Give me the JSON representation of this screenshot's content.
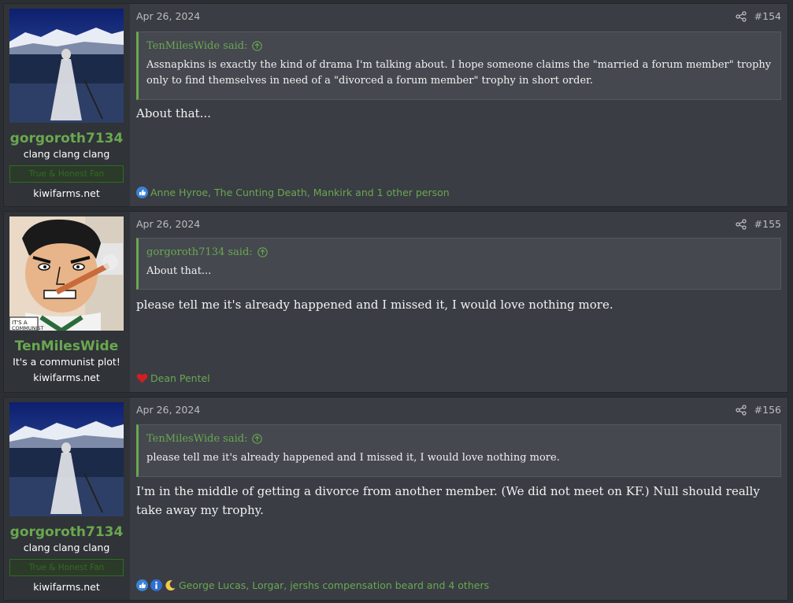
{
  "posts": [
    {
      "username": "gorgoroth7134",
      "user_title": "clang clang clang",
      "banner": "True & Honest Fan",
      "site": "kiwifarms.net",
      "date": "Apr 26, 2024",
      "post_number": "#154",
      "quote": {
        "author": "TenMilesWide said:",
        "text": "Assnapkins is exactly the kind of drama I'm talking about. I hope someone claims the \"married a forum member\" trophy only to find themselves in need of a \"divorced a forum member\" trophy in short order."
      },
      "message": "About that...",
      "reactions": {
        "icons": [
          "like-icon"
        ],
        "text": "Anne Hyroe, The Cunting Death, Mankirk and 1 other person"
      }
    },
    {
      "username": "TenMilesWide",
      "user_title": "It's a communist plot!",
      "site": "kiwifarms.net",
      "date": "Apr 26, 2024",
      "post_number": "#155",
      "quote": {
        "author": "gorgoroth7134 said:",
        "text": "About that..."
      },
      "message": "please tell me it's already happened and I missed it, I would love nothing more.",
      "reactions": {
        "icons": [
          "heart-icon"
        ],
        "text": "Dean Pentel"
      }
    },
    {
      "username": "gorgoroth7134",
      "user_title": "clang clang clang",
      "banner": "True & Honest Fan",
      "site": "kiwifarms.net",
      "date": "Apr 26, 2024",
      "post_number": "#156",
      "quote": {
        "author": "TenMilesWide said:",
        "text": "please tell me it's already happened and I missed it, I would love nothing more."
      },
      "message": "I'm in the middle of getting a divorce from another member. (We did not meet on KF.) Null should really take away my trophy.",
      "reactions": {
        "icons": [
          "like-icon",
          "informative-icon",
          "moon-icon"
        ],
        "text": "George Lucas, Lorgar, jershs compensation beard and 4 others"
      }
    }
  ],
  "colors": {
    "accent": "#6aa84f",
    "background": "#2b2e33",
    "post_bg": "#3a3d44",
    "user_col_bg": "#303338"
  }
}
